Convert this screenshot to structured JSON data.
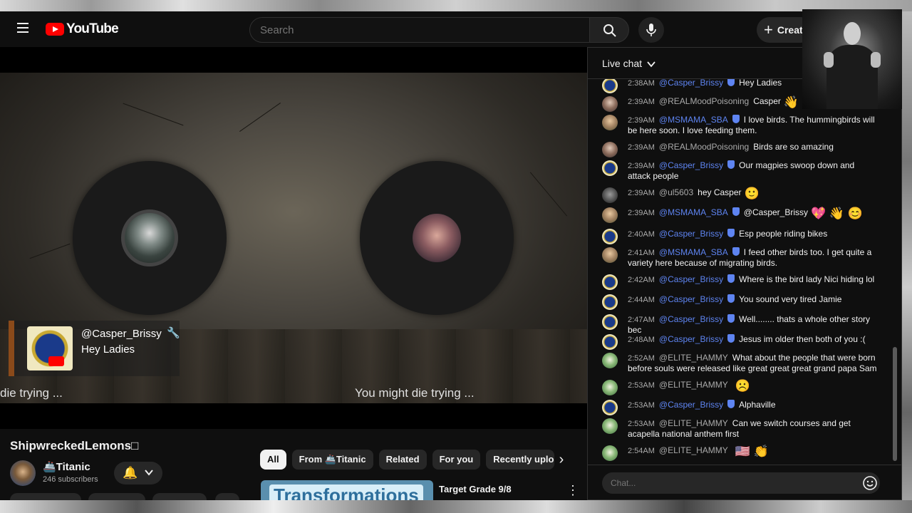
{
  "masthead": {
    "logo_text": "YouTube",
    "search_placeholder": "Search",
    "create_label": "Creat"
  },
  "video": {
    "notice_author": "@Casper_Brissy",
    "notice_text": "Hey Ladies",
    "caption_left": "die trying ...",
    "caption_right": "You might die trying ..."
  },
  "info": {
    "title": "ShipwreckedLemons□",
    "channel_name": "🚢Titanic",
    "subscribers": "246 subscribers"
  },
  "chips": {
    "all": "All",
    "from": "From 🚢Titanic",
    "related": "Related",
    "for_you": "For you",
    "recent": "Recently uploaded"
  },
  "related": {
    "thumb_text": "Transformations",
    "title": "Target Grade 9/8"
  },
  "chat": {
    "header": "Live chat",
    "input_placeholder": "Chat...",
    "messages": [
      {
        "time": "2:38AM",
        "author": "@Casper_Brissy",
        "text": "Hey Ladies",
        "emoji": ""
      },
      {
        "time": "2:39AM",
        "author": "@REALMoodPoisoning",
        "text": "Casper",
        "emoji": "👋"
      },
      {
        "time": "2:39AM",
        "author": "@MSMAMA_SBA",
        "text": "I love birds. The hummingbirds will be here soon. I love feeding them.",
        "emoji": ""
      },
      {
        "time": "2:39AM",
        "author": "@REALMoodPoisoning",
        "text": "Birds are so amazing",
        "emoji": ""
      },
      {
        "time": "2:39AM",
        "author": "@Casper_Brissy",
        "text": "Our magpies swoop down and attack people",
        "emoji": ""
      },
      {
        "time": "2:39AM",
        "author": "@ul5603",
        "text": "hey Casper",
        "emoji": "🙂"
      },
      {
        "time": "2:39AM",
        "author": "@MSMAMA_SBA",
        "text": "@Casper_Brissy",
        "emoji": "💖 👋 😊"
      },
      {
        "time": "2:40AM",
        "author": "@Casper_Brissy",
        "text": "Esp people riding bikes",
        "emoji": ""
      },
      {
        "time": "2:41AM",
        "author": "@MSMAMA_SBA",
        "text": "I feed other birds too. I get quite a variety here because of migrating birds.",
        "emoji": ""
      },
      {
        "time": "2:42AM",
        "author": "@Casper_Brissy",
        "text": "Where is the bird lady Nici hiding lol",
        "emoji": ""
      },
      {
        "time": "2:44AM",
        "author": "@Casper_Brissy",
        "text": "You sound very tired Jamie",
        "emoji": ""
      },
      {
        "time": "2:47AM",
        "author": "@Casper_Brissy",
        "text": "Well........ thats a whole other story bec",
        "emoji": ""
      },
      {
        "time": "2:48AM",
        "author": "@Casper_Brissy",
        "text": "Jesus im older then both of you :(",
        "emoji": ""
      },
      {
        "time": "2:52AM",
        "author": "@ELITE_HAMMY",
        "text": "What about the people that were born before souls were released like great great great grand papa Sam",
        "emoji": ""
      },
      {
        "time": "2:53AM",
        "author": "@ELITE_HAMMY",
        "text": "",
        "emoji": "☹️"
      },
      {
        "time": "2:53AM",
        "author": "@Casper_Brissy",
        "text": "Alphaville",
        "emoji": ""
      },
      {
        "time": "2:53AM",
        "author": "@ELITE_HAMMY",
        "text": "Can we switch courses and get acapella national anthem first",
        "emoji": ""
      },
      {
        "time": "2:54AM",
        "author": "@ELITE_HAMMY",
        "text": "",
        "emoji": "🇺🇸 👏"
      }
    ]
  }
}
